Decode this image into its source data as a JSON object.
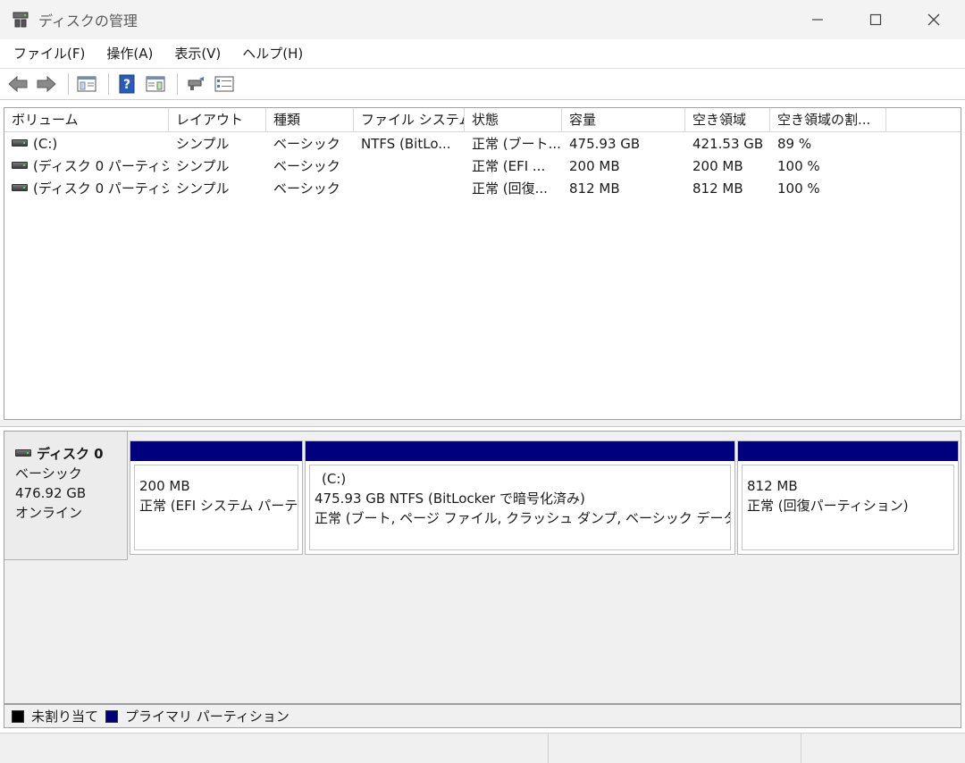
{
  "window": {
    "title": "ディスクの管理",
    "icon": "disk-management-icon",
    "controls": [
      "minimize-icon",
      "maximize-icon",
      "close-icon"
    ]
  },
  "menu": [
    {
      "label": "ファイル(F)"
    },
    {
      "label": "操作(A)"
    },
    {
      "label": "表示(V)"
    },
    {
      "label": "ヘルプ(H)"
    }
  ],
  "toolbar": [
    "back-arrow-icon",
    "forward-arrow-icon",
    "console-tree-icon",
    "help-icon",
    "properties-pane-icon",
    "connect-icon",
    "properties-icon"
  ],
  "volume_list": {
    "columns": [
      "ボリューム",
      "レイアウト",
      "種類",
      "ファイル システム",
      "状態",
      "容量",
      "空き領域",
      "空き領域の割..."
    ],
    "rows": [
      [
        "(C:)",
        "シンプル",
        "ベーシック",
        "NTFS (BitLo...",
        "正常 (ブート...",
        "475.93 GB",
        "421.53 GB",
        "89 %"
      ],
      [
        "(ディスク 0 パーティシ...",
        "シンプル",
        "ベーシック",
        "",
        "正常 (EFI ...",
        "200 MB",
        "200 MB",
        "100 %"
      ],
      [
        "(ディスク 0 パーティシ...",
        "シンプル",
        "ベーシック",
        "",
        "正常 (回復...",
        "812 MB",
        "812 MB",
        "100 %"
      ]
    ]
  },
  "disk": {
    "name": "ディスク 0",
    "type": "ベーシック",
    "size": "476.92 GB",
    "status": "オンライン",
    "partitions": [
      {
        "title": "",
        "line1": "200 MB",
        "line2": "正常 (EFI システム パーティ"
      },
      {
        "title": "(C:)",
        "line1": "475.93 GB NTFS (BitLocker で暗号化済み)",
        "line2": "正常 (ブート, ページ ファイル, クラッシュ ダンプ, ベーシック データ パーティ"
      },
      {
        "title": "",
        "line1": "812 MB",
        "line2": "正常 (回復パーティション)"
      }
    ]
  },
  "legend": [
    {
      "label": "未割り当て",
      "color": "#000000"
    },
    {
      "label": "プライマリ パーティション",
      "color": "#00007f"
    }
  ]
}
